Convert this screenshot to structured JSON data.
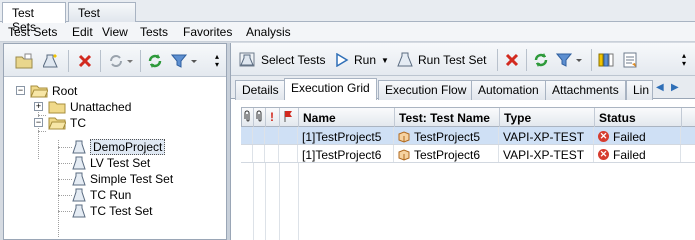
{
  "top_tabs": [
    {
      "label": "Test Sets",
      "active": true
    },
    {
      "label": "Test Runs",
      "active": false
    }
  ],
  "menu": [
    "Test Sets",
    "Edit",
    "View",
    "Tests",
    "Favorites",
    "Analysis"
  ],
  "left_toolbar": {
    "icons": [
      "new-folder-icon",
      "new-test-set-icon",
      "delete-icon",
      "cycle-icon",
      "refresh-icon",
      "filter-icon"
    ]
  },
  "tree": {
    "root": "Root",
    "unattached": "Unattached",
    "tc": "TC",
    "children": [
      "DemoProject",
      "LV Test Set",
      "Simple Test Set",
      "TC Run",
      "TC Test Set"
    ]
  },
  "right_toolbar": {
    "select_tests": "Select Tests",
    "run": "Run",
    "run_test_set": "Run Test Set"
  },
  "sub_tabs": [
    "Details",
    "Execution Grid",
    "Execution Flow",
    "Automation",
    "Attachments",
    "Lin"
  ],
  "active_sub_tab": "Execution Grid",
  "grid": {
    "headers": {
      "name": "Name",
      "test_name": "Test: Test Name",
      "type": "Type",
      "status": "Status"
    },
    "rows": [
      {
        "name": "[1]TestProject5",
        "test_name": "TestProject5",
        "type": "VAPI-XP-TEST",
        "status": "Failed",
        "selected": true
      },
      {
        "name": "[1]TestProject6",
        "test_name": "TestProject6",
        "type": "VAPI-XP-TEST",
        "status": "Failed",
        "selected": false
      }
    ]
  },
  "colors": {
    "accent_blue": "#2f6fb7",
    "selected_row": "#cfe0f5",
    "failed_red": "#d63c2f",
    "refresh_green": "#2e9a3b"
  }
}
